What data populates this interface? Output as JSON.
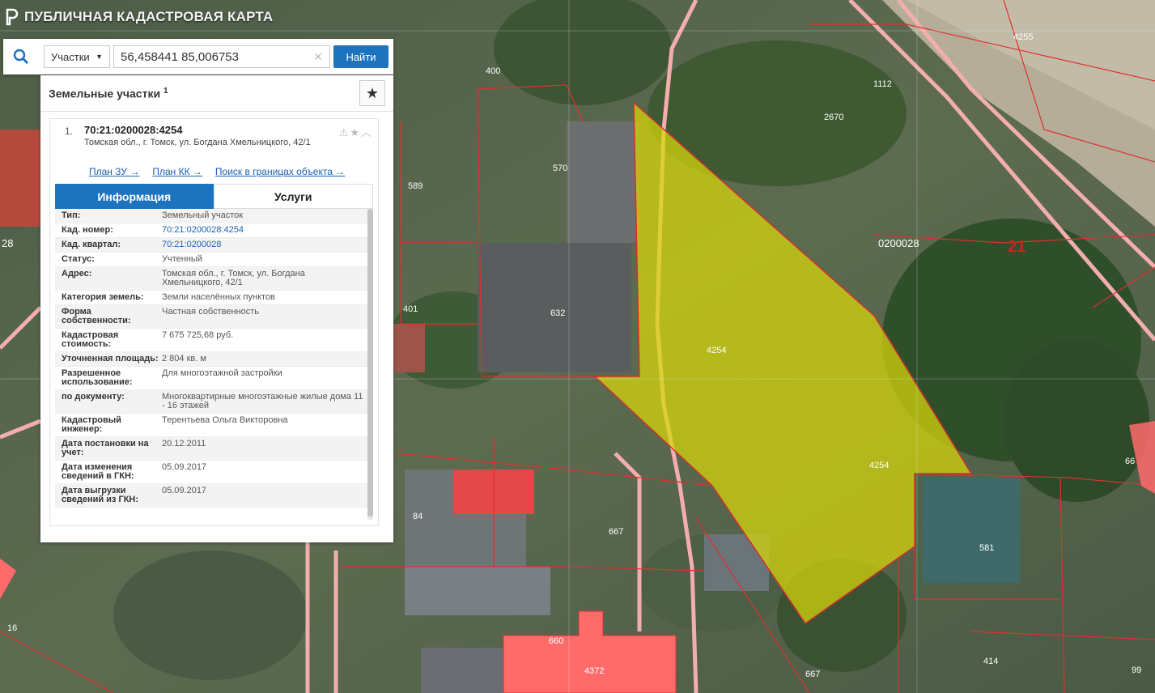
{
  "app": {
    "title": "ПУБЛИЧНАЯ КАДАСТРОВАЯ КАРТА"
  },
  "search": {
    "type_label": "Участки",
    "query": "56,458441 85,006753",
    "submit_label": "Найти"
  },
  "panel": {
    "title": "Земельные участки",
    "count": "1"
  },
  "result": {
    "number": "1.",
    "cad_number": "70:21:0200028:4254",
    "address": "Томская обл., г. Томск, ул. Богдана Хмельницкого, 42/1",
    "links": [
      "План ЗУ →",
      "План КК →",
      "Поиск в границах объекта →"
    ]
  },
  "tabs": {
    "info": "Информация",
    "services": "Услуги"
  },
  "info_rows": [
    {
      "label": "Тип:",
      "value": "Земельный участок"
    },
    {
      "label": "Кад. номер:",
      "value": "70:21:0200028:4254"
    },
    {
      "label": "Кад. квартал:",
      "value": "70:21:0200028"
    },
    {
      "label": "Статус:",
      "value": "Учтенный"
    },
    {
      "label": "Адрес:",
      "value": "Томская обл., г. Томск, ул. Богдана Хмельницкого, 42/1"
    },
    {
      "label": "Категория земель:",
      "value": "Земли населённых пунктов"
    },
    {
      "label": "Форма собственности:",
      "value": "Частная собственность"
    },
    {
      "label": "Кадастровая стоимость:",
      "value": "7 675 725,68 руб."
    },
    {
      "label": "Уточненная площадь:",
      "value": "2 804 кв. м"
    },
    {
      "label": "Разрешенное использование:",
      "value": "Для многоэтажной застройки"
    },
    {
      "label": "по документу:",
      "value": "Многоквартирные многоэтажные жилые дома 11 - 16 этажей"
    },
    {
      "label": "Кадастровый инженер:",
      "value": "Терентьева Ольга Викторовна"
    },
    {
      "label": "Дата постановки на учет:",
      "value": "20.12.2011"
    },
    {
      "label": "Дата изменения сведений в ГКН:",
      "value": "05.09.2017"
    },
    {
      "label": "Дата выгрузки сведений из ГКН:",
      "value": "05.09.2017"
    }
  ],
  "map_labels": {
    "l4255": "4255",
    "l1112": "1112",
    "l2670": "2670",
    "l400": "400",
    "l570": "570",
    "l589": "589",
    "l0200028": "0200028",
    "l21": "21",
    "l401": "401",
    "l632": "632",
    "l4254a": "4254",
    "l4254b": "4254",
    "l66": "66",
    "l84": "84",
    "l667a": "667",
    "l581": "581",
    "l660": "660",
    "l4372": "4372",
    "l16": "16",
    "l414": "414",
    "l667b": "667",
    "l99": "99",
    "l28": "28"
  },
  "colors": {
    "selected_parcel": "#d8d80a",
    "parcel_border": "#e03030",
    "building_fill": "#ff6b6b",
    "accent": "#1e73be"
  }
}
